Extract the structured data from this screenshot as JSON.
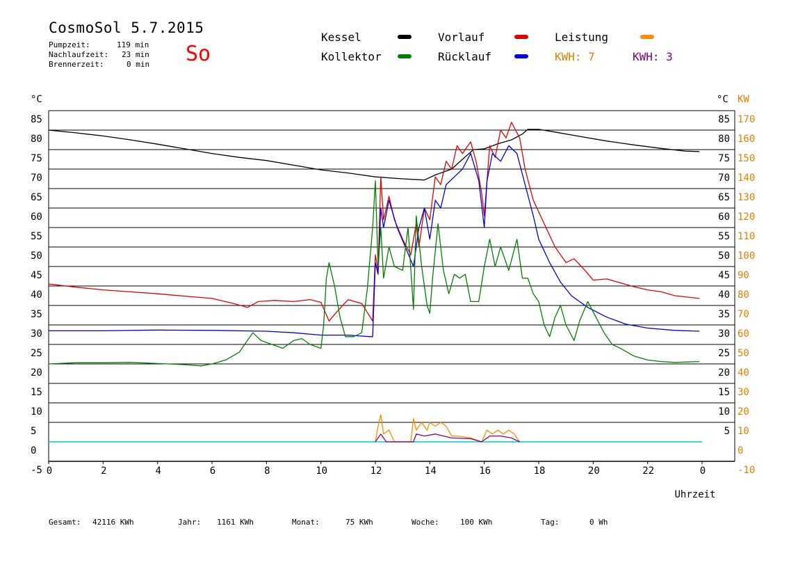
{
  "header": {
    "title": "CosmoSol 5.7.2015",
    "day": "So",
    "pumpzeit_label": "Pumpzeit:",
    "pumpzeit_value": "119 min",
    "nachlauf_label": "Nachlaufzeit:",
    "nachlauf_value": "23 min",
    "brenner_label": "Brennerzeit:",
    "brenner_value": "0 min"
  },
  "legend": {
    "kessel": "Kessel",
    "kollektor": "Kollektor",
    "vorlauf": "Vorlauf",
    "ruecklauf": "Rücklauf",
    "leistung": "Leistung",
    "kwh1": "KWH: 7",
    "kwh2": "KWH: 3"
  },
  "colors": {
    "kessel": "#000000",
    "kollektor": "#008000",
    "vorlauf": "#e00000",
    "ruecklauf": "#0000e0",
    "leistung": "#ff8c00",
    "kwh2": "#800080",
    "baseline": "#00c8c8",
    "right_axis": "#e08000",
    "day": "#ff0000"
  },
  "footer": {
    "gesamt_label": "Gesamt:",
    "gesamt_value": "42116 KWh",
    "jahr_label": "Jahr:",
    "jahr_value": "1161 KWh",
    "monat_label": "Monat:",
    "monat_value": "75 KWh",
    "woche_label": "Woche:",
    "woche_value": "100 KWh",
    "tag_label": "Tag:",
    "tag_value": "0 Wh"
  },
  "chart_data": {
    "type": "line",
    "xlabel": "Uhrzeit",
    "ylabel_left": "°C",
    "ylabel_right_unit": "°C",
    "ylabel_right_kw": "KW",
    "xlim": [
      0,
      24
    ],
    "ylim": [
      -5,
      90
    ],
    "x_ticks": [
      "0",
      "2",
      "4",
      "6",
      "8",
      "10",
      "12",
      "14",
      "16",
      "18",
      "20",
      "22",
      "0"
    ],
    "y_ticks_left": [
      "85",
      "80",
      "75",
      "70",
      "65",
      "60",
      "55",
      "50",
      "45",
      "40",
      "35",
      "30",
      "25",
      "20",
      "15",
      "10",
      "5",
      "0",
      "-5"
    ],
    "y_ticks_right_c": [
      "85",
      "80",
      "75",
      "70",
      "65",
      "60",
      "55",
      "50",
      "45",
      "40",
      "35",
      "30",
      "25",
      "20",
      "15",
      "10",
      "5"
    ],
    "y_ticks_right_kw": [
      "170",
      "160",
      "150",
      "140",
      "130",
      "120",
      "110",
      "100",
      "90",
      "80",
      "70",
      "60",
      "50",
      "40",
      "30",
      "20",
      "10",
      "0",
      "-10"
    ],
    "grid": true,
    "series": [
      {
        "name": "Kessel",
        "color": "#000000",
        "points": [
          [
            0,
            80
          ],
          [
            1,
            79.3
          ],
          [
            2,
            78.5
          ],
          [
            3,
            77.5
          ],
          [
            4,
            76.4
          ],
          [
            5,
            75.2
          ],
          [
            6,
            74
          ],
          [
            7,
            73
          ],
          [
            8,
            72.2
          ],
          [
            9,
            71
          ],
          [
            10,
            69.8
          ],
          [
            11,
            69
          ],
          [
            12,
            68
          ],
          [
            13,
            67.5
          ],
          [
            13.8,
            67.2
          ],
          [
            14.2,
            68.5
          ],
          [
            14.8,
            70
          ],
          [
            15.2,
            72.5
          ],
          [
            15.6,
            75
          ],
          [
            16,
            75.2
          ],
          [
            16.5,
            76.5
          ],
          [
            17,
            77.5
          ],
          [
            17.4,
            79
          ],
          [
            17.6,
            80.2
          ],
          [
            18,
            80.2
          ],
          [
            18.6,
            79.5
          ],
          [
            19.5,
            78.4
          ],
          [
            20.5,
            77.2
          ],
          [
            21.5,
            76.2
          ],
          [
            22.5,
            75.3
          ],
          [
            23.4,
            74.6
          ],
          [
            23.9,
            74.5
          ]
        ]
      },
      {
        "name": "Vorlauf",
        "color": "#e00000",
        "points": [
          [
            0,
            40.5
          ],
          [
            1,
            39.7
          ],
          [
            2,
            39
          ],
          [
            3,
            38.5
          ],
          [
            4,
            38
          ],
          [
            5,
            37.4
          ],
          [
            6,
            36.8
          ],
          [
            6.8,
            35.5
          ],
          [
            7.3,
            34.5
          ],
          [
            7.7,
            36
          ],
          [
            8.3,
            36.3
          ],
          [
            9,
            36
          ],
          [
            9.6,
            36.5
          ],
          [
            10,
            35.8
          ],
          [
            10.3,
            31
          ],
          [
            10.6,
            33.5
          ],
          [
            11,
            36.5
          ],
          [
            11.5,
            35.5
          ],
          [
            11.9,
            31
          ],
          [
            12,
            48
          ],
          [
            12.1,
            44
          ],
          [
            12.2,
            68
          ],
          [
            12.3,
            57
          ],
          [
            12.5,
            63
          ],
          [
            12.7,
            57
          ],
          [
            13,
            52
          ],
          [
            13.3,
            48
          ],
          [
            13.5,
            56
          ],
          [
            13.6,
            50
          ],
          [
            13.8,
            60
          ],
          [
            14,
            57
          ],
          [
            14.2,
            68
          ],
          [
            14.4,
            66
          ],
          [
            14.6,
            72
          ],
          [
            14.8,
            70
          ],
          [
            15,
            76
          ],
          [
            15.2,
            74
          ],
          [
            15.5,
            77
          ],
          [
            15.7,
            72
          ],
          [
            15.9,
            64
          ],
          [
            16,
            58
          ],
          [
            16.2,
            76
          ],
          [
            16.4,
            73
          ],
          [
            16.6,
            80
          ],
          [
            16.8,
            78
          ],
          [
            17,
            82
          ],
          [
            17.3,
            78
          ],
          [
            17.5,
            70
          ],
          [
            17.8,
            62
          ],
          [
            18.2,
            56
          ],
          [
            18.6,
            50
          ],
          [
            19,
            46
          ],
          [
            19.3,
            47
          ],
          [
            19.7,
            44
          ],
          [
            20,
            41.5
          ],
          [
            20.5,
            41.8
          ],
          [
            21,
            40.8
          ],
          [
            21.5,
            39.8
          ],
          [
            22,
            39
          ],
          [
            22.5,
            38.5
          ],
          [
            23,
            37.5
          ],
          [
            23.9,
            36.8
          ]
        ]
      },
      {
        "name": "Rücklauf",
        "color": "#0000e0",
        "points": [
          [
            0,
            28.5
          ],
          [
            2,
            28.5
          ],
          [
            4,
            28.7
          ],
          [
            6,
            28.6
          ],
          [
            8,
            28.4
          ],
          [
            9,
            28
          ],
          [
            10,
            27.4
          ],
          [
            11,
            27.4
          ],
          [
            11.8,
            27
          ],
          [
            11.9,
            27
          ],
          [
            12,
            46
          ],
          [
            12.1,
            43
          ],
          [
            12.2,
            60
          ],
          [
            12.3,
            55
          ],
          [
            12.5,
            62
          ],
          [
            12.8,
            55
          ],
          [
            13.1,
            50
          ],
          [
            13.4,
            45
          ],
          [
            13.6,
            55
          ],
          [
            13.8,
            60
          ],
          [
            14,
            52
          ],
          [
            14.2,
            62
          ],
          [
            14.4,
            60
          ],
          [
            14.6,
            66
          ],
          [
            14.9,
            68
          ],
          [
            15.2,
            70
          ],
          [
            15.5,
            74
          ],
          [
            15.8,
            67
          ],
          [
            16,
            55
          ],
          [
            16.1,
            67
          ],
          [
            16.3,
            74
          ],
          [
            16.6,
            72
          ],
          [
            16.9,
            76
          ],
          [
            17.2,
            74
          ],
          [
            17.5,
            66
          ],
          [
            17.8,
            58
          ],
          [
            18,
            52
          ],
          [
            18.4,
            46
          ],
          [
            18.8,
            41
          ],
          [
            19.2,
            37.5
          ],
          [
            19.8,
            34.5
          ],
          [
            20.5,
            32
          ],
          [
            21.2,
            30.2
          ],
          [
            22,
            29.2
          ],
          [
            23,
            28.6
          ],
          [
            23.9,
            28.4
          ]
        ]
      },
      {
        "name": "Kollektor",
        "color": "#008000",
        "points": [
          [
            0,
            20
          ],
          [
            1,
            20.3
          ],
          [
            2,
            20.3
          ],
          [
            3,
            20.4
          ],
          [
            4,
            20.1
          ],
          [
            5,
            19.8
          ],
          [
            5.6,
            19.5
          ],
          [
            6,
            20
          ],
          [
            6.5,
            21
          ],
          [
            7,
            23
          ],
          [
            7.3,
            26
          ],
          [
            7.5,
            28
          ],
          [
            7.8,
            26
          ],
          [
            8.2,
            25
          ],
          [
            8.6,
            24
          ],
          [
            9,
            26
          ],
          [
            9.3,
            26.5
          ],
          [
            9.6,
            25
          ],
          [
            10,
            24
          ],
          [
            10.1,
            30
          ],
          [
            10.2,
            42
          ],
          [
            10.3,
            46
          ],
          [
            10.5,
            40
          ],
          [
            10.7,
            32
          ],
          [
            10.9,
            27
          ],
          [
            11.2,
            27
          ],
          [
            11.5,
            28
          ],
          [
            11.7,
            39
          ],
          [
            11.9,
            55
          ],
          [
            12,
            67
          ],
          [
            12.1,
            45
          ],
          [
            12.2,
            55
          ],
          [
            12.3,
            42
          ],
          [
            12.5,
            50
          ],
          [
            12.7,
            45
          ],
          [
            13,
            44
          ],
          [
            13.2,
            55
          ],
          [
            13.4,
            34
          ],
          [
            13.5,
            58
          ],
          [
            13.7,
            45
          ],
          [
            13.9,
            35
          ],
          [
            14,
            33
          ],
          [
            14.1,
            42
          ],
          [
            14.3,
            56
          ],
          [
            14.5,
            44
          ],
          [
            14.7,
            38
          ],
          [
            14.9,
            43
          ],
          [
            15.1,
            42
          ],
          [
            15.3,
            43
          ],
          [
            15.5,
            36
          ],
          [
            15.8,
            36
          ],
          [
            16,
            45
          ],
          [
            16.2,
            52
          ],
          [
            16.4,
            45
          ],
          [
            16.6,
            50
          ],
          [
            16.9,
            44
          ],
          [
            17.2,
            52
          ],
          [
            17.4,
            42
          ],
          [
            17.6,
            42
          ],
          [
            17.8,
            38
          ],
          [
            18,
            36
          ],
          [
            18.2,
            30
          ],
          [
            18.4,
            27
          ],
          [
            18.6,
            32
          ],
          [
            18.8,
            35
          ],
          [
            19,
            30
          ],
          [
            19.3,
            26
          ],
          [
            19.5,
            31
          ],
          [
            19.8,
            36
          ],
          [
            20.1,
            32
          ],
          [
            20.4,
            28
          ],
          [
            20.7,
            25
          ],
          [
            21,
            24
          ],
          [
            21.5,
            22
          ],
          [
            22,
            21
          ],
          [
            22.5,
            20.6
          ],
          [
            23,
            20.4
          ],
          [
            23.9,
            20.6
          ]
        ]
      },
      {
        "name": "Leistung",
        "color": "#ff8c00",
        "points": [
          [
            12,
            0
          ],
          [
            12.1,
            4
          ],
          [
            12.2,
            7
          ],
          [
            12.3,
            2
          ],
          [
            12.5,
            3
          ],
          [
            12.7,
            0
          ],
          [
            13.3,
            0
          ],
          [
            13.4,
            6
          ],
          [
            13.5,
            3
          ],
          [
            13.7,
            5
          ],
          [
            13.9,
            3
          ],
          [
            14,
            5
          ],
          [
            14.2,
            4
          ],
          [
            14.4,
            5
          ],
          [
            14.6,
            4
          ],
          [
            14.8,
            1.5
          ],
          [
            15,
            1.5
          ],
          [
            15.5,
            1
          ],
          [
            15.9,
            0
          ],
          [
            16.1,
            3
          ],
          [
            16.3,
            2
          ],
          [
            16.5,
            3
          ],
          [
            16.7,
            2
          ],
          [
            16.9,
            3
          ],
          [
            17.1,
            2
          ],
          [
            17.3,
            0
          ]
        ]
      },
      {
        "name": "KWH 3",
        "color": "#800080",
        "points": [
          [
            12,
            0
          ],
          [
            12.2,
            2
          ],
          [
            12.4,
            0
          ],
          [
            13.4,
            0
          ],
          [
            13.5,
            2
          ],
          [
            13.8,
            1.5
          ],
          [
            14.2,
            2
          ],
          [
            14.5,
            1.5
          ],
          [
            14.8,
            1
          ],
          [
            15.5,
            0.8
          ],
          [
            15.9,
            0
          ],
          [
            16.2,
            1.5
          ],
          [
            16.6,
            1.5
          ],
          [
            17,
            1
          ],
          [
            17.3,
            0
          ]
        ]
      }
    ],
    "baseline": 0
  }
}
